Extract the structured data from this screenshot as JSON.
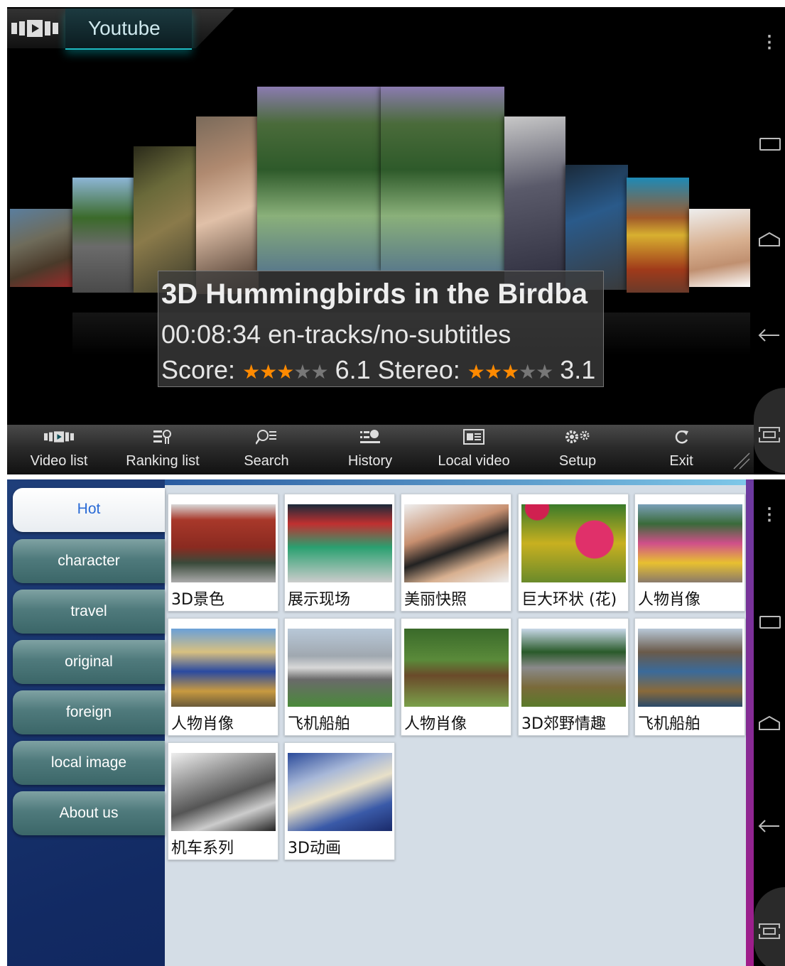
{
  "top": {
    "app_title": "Youtube",
    "app_icon": "film-strip-icon",
    "video": {
      "title": "3D Hummingbirds in the Birdba",
      "details": "00:08:34 en-tracks/no-subtitles",
      "score_label": "Score:",
      "score_stars": 3,
      "score_value": "6.1",
      "stereo_label": "Stereo:",
      "stereo_stars": 3,
      "stereo_value": "3.1"
    },
    "toolbar": [
      {
        "label": "Video list",
        "icon": "film-strip-icon",
        "active": true
      },
      {
        "label": "Ranking list",
        "icon": "ranking-icon",
        "active": false
      },
      {
        "label": "Search",
        "icon": "search-icon",
        "active": false
      },
      {
        "label": "History",
        "icon": "history-icon",
        "active": false
      },
      {
        "label": "Local video",
        "icon": "local-video-icon",
        "active": false
      },
      {
        "label": "Setup",
        "icon": "gear-icon",
        "active": false
      },
      {
        "label": "Exit",
        "icon": "refresh-icon",
        "active": false
      }
    ]
  },
  "bottom": {
    "categories": [
      {
        "label": "Hot",
        "active": true
      },
      {
        "label": "character",
        "active": false
      },
      {
        "label": "travel",
        "active": false
      },
      {
        "label": "original",
        "active": false
      },
      {
        "label": "foreign",
        "active": false
      },
      {
        "label": "local image",
        "active": false
      },
      {
        "label": "About us",
        "active": false
      }
    ],
    "items": [
      {
        "caption": "3D景色"
      },
      {
        "caption": "展示现场"
      },
      {
        "caption": "美丽快照"
      },
      {
        "caption": "巨大环状 (花)"
      },
      {
        "caption": "人物肖像"
      },
      {
        "caption": "人物肖像"
      },
      {
        "caption": "飞机船舶"
      },
      {
        "caption": "人物肖像"
      },
      {
        "caption": "3D郊野情趣"
      },
      {
        "caption": "飞机船舶"
      },
      {
        "caption": "机车系列"
      },
      {
        "caption": "3D动画"
      }
    ]
  },
  "colors": {
    "accent_teal": "#1fb9c0",
    "star_on": "#ff8a00",
    "category_active_text": "#2a6bd6",
    "content_bg": "#d4dde6"
  }
}
